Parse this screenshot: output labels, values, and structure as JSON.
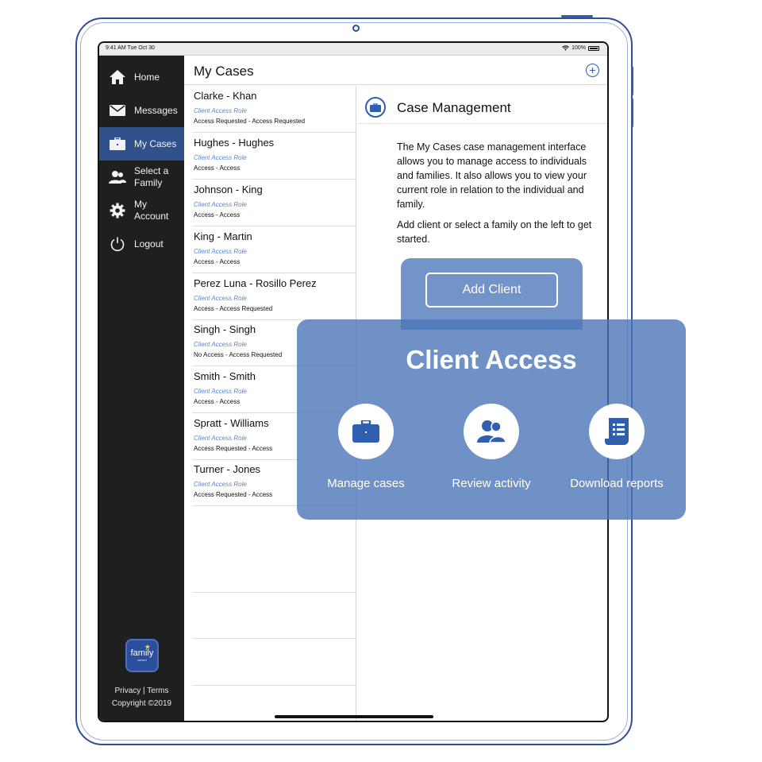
{
  "status_bar": {
    "time": "9:41 AM  Tue Oct 30",
    "battery": "100%"
  },
  "sidebar": {
    "items": [
      {
        "label": "Home",
        "icon": "home-icon"
      },
      {
        "label": "Messages",
        "icon": "envelope-icon"
      },
      {
        "label": "My Cases",
        "icon": "briefcase-icon",
        "active": true
      },
      {
        "label": "Select a Family",
        "icon": "people-icon"
      },
      {
        "label": "My Account",
        "icon": "gear-icon"
      },
      {
        "label": "Logout",
        "icon": "power-icon"
      }
    ],
    "logo_text": "family",
    "logo_sub": "wizard",
    "footer_links": "Privacy  |  Terms",
    "copyright": "Copyright ©2019"
  },
  "header": {
    "title": "My Cases",
    "add_icon": "plus-circle-icon"
  },
  "cases": [
    {
      "name": "Clarke - Khan",
      "role": "Client Access Role",
      "status": "Access Requested - Access Requested"
    },
    {
      "name": "Hughes - Hughes",
      "role": "Client Access Role",
      "status": "Access - Access"
    },
    {
      "name": "Johnson - King",
      "role": "Client Access Role",
      "status": "Access - Access"
    },
    {
      "name": "King - Martin",
      "role": "Client Access Role",
      "status": "Access - Access"
    },
    {
      "name": "Perez Luna - Rosillo Perez",
      "role": "Client Access Role",
      "status": "Access - Access Requested"
    },
    {
      "name": "Singh - Singh",
      "role": "Client Access Role",
      "status": "No Access - Access Requested"
    },
    {
      "name": "Smith - Smith",
      "role": "Client Access Role",
      "status": "Access - Access"
    },
    {
      "name": "Spratt - Williams",
      "role": "Client Access Role",
      "status": "Access Requested - Access"
    },
    {
      "name": "Turner - Jones",
      "role": "Client Access Role",
      "status": "Access Requested - Access"
    }
  ],
  "detail": {
    "title": "Case Management",
    "paragraph1": "The My Cases case management interface allows you to manage access to individuals and families.  It also allows you to view your current role in relation to the individual and family.",
    "paragraph2": "Add client or select a family on the left to get started."
  },
  "callout": {
    "add_client_label": "Add Client",
    "heading": "Client Access",
    "features": [
      {
        "label": "Manage cases",
        "icon": "briefcase-icon"
      },
      {
        "label": "Review activity",
        "icon": "people-icon"
      },
      {
        "label": "Download reports",
        "icon": "report-icon"
      }
    ]
  },
  "colors": {
    "sidebar_bg": "#1f1f1f",
    "active_nav": "#2e5289",
    "accent_blue": "#2f5fae",
    "callout": "#4c76b8"
  }
}
